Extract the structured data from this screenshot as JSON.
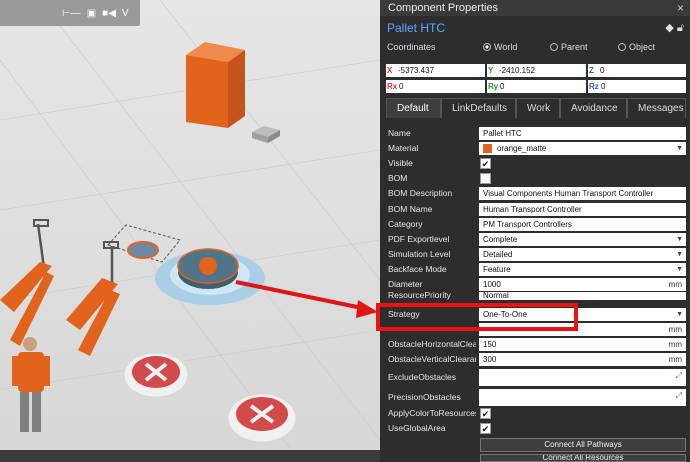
{
  "viewport": {
    "toolbar_icons": [
      "measure-icon",
      "image-icon",
      "camera-icon",
      "visual-components-logo"
    ]
  },
  "panel": {
    "title": "Component Properties",
    "close_glyph": "×",
    "component_name": "Pallet HTC",
    "coordinates": {
      "label": "Coordinates",
      "options": [
        "World",
        "Parent",
        "Object"
      ],
      "selected": "World",
      "x": {
        "label": "X",
        "value": "-5373.437"
      },
      "y": {
        "label": "Y",
        "value": "-2410.152"
      },
      "z": {
        "label": "Z",
        "value": "0"
      },
      "rx": {
        "label": "Rx",
        "value": "0"
      },
      "ry": {
        "label": "Ry",
        "value": "0"
      },
      "rz": {
        "label": "Rz",
        "value": "0"
      }
    },
    "tabs": [
      "Default",
      "LinkDefaults",
      "Work",
      "Avoidance",
      "Messages"
    ],
    "active_tab": "Default",
    "properties": {
      "name": {
        "label": "Name",
        "value": "Pallet HTC"
      },
      "material": {
        "label": "Material",
        "value": "orange_matte",
        "swatch": "#e2641c"
      },
      "visible": {
        "label": "Visible",
        "checked": "✔"
      },
      "bom": {
        "label": "BOM"
      },
      "bom_description": {
        "label": "BOM Description",
        "value": "Visual Components Human Transport Controller"
      },
      "bom_name": {
        "label": "BOM Name",
        "value": "Human Transport Controller"
      },
      "category": {
        "label": "Category",
        "value": "PM Transport Controllers"
      },
      "pdf_export": {
        "label": "PDF Exportlevel",
        "value": "Complete"
      },
      "sim_level": {
        "label": "Simulation Level",
        "value": "Detailed"
      },
      "backface": {
        "label": "Backface Mode",
        "value": "Feature"
      },
      "diameter": {
        "label": "Diameter",
        "value": "1000",
        "unit": "mm"
      },
      "resource_priority": {
        "label": "ResourcePriority",
        "value": "Normal"
      },
      "strategy": {
        "label": "Strategy",
        "value": "One-To-One"
      },
      "hidden_unit": {
        "unit": "mm"
      },
      "obstacle_h": {
        "label": "ObstacleHorizontalClea...",
        "value": "150",
        "unit": "mm"
      },
      "obstacle_v": {
        "label": "ObstacleVerticalClearan...",
        "value": "300",
        "unit": "mm"
      },
      "exclude": {
        "label": "ExcludeObstacles"
      },
      "precision": {
        "label": "PrecisionObstacles"
      },
      "apply_color": {
        "label": "ApplyColorToResources",
        "checked": "✔"
      },
      "use_global": {
        "label": "UseGlobalArea",
        "checked": "✔"
      },
      "connect_pathways": {
        "label": "Connect All Pathways"
      },
      "connect_resources": {
        "label": "Connect All Resources"
      }
    }
  },
  "colors": {
    "accent": "#5aa8ff",
    "highlight": "#ee1111",
    "orange": "#e2641c"
  }
}
